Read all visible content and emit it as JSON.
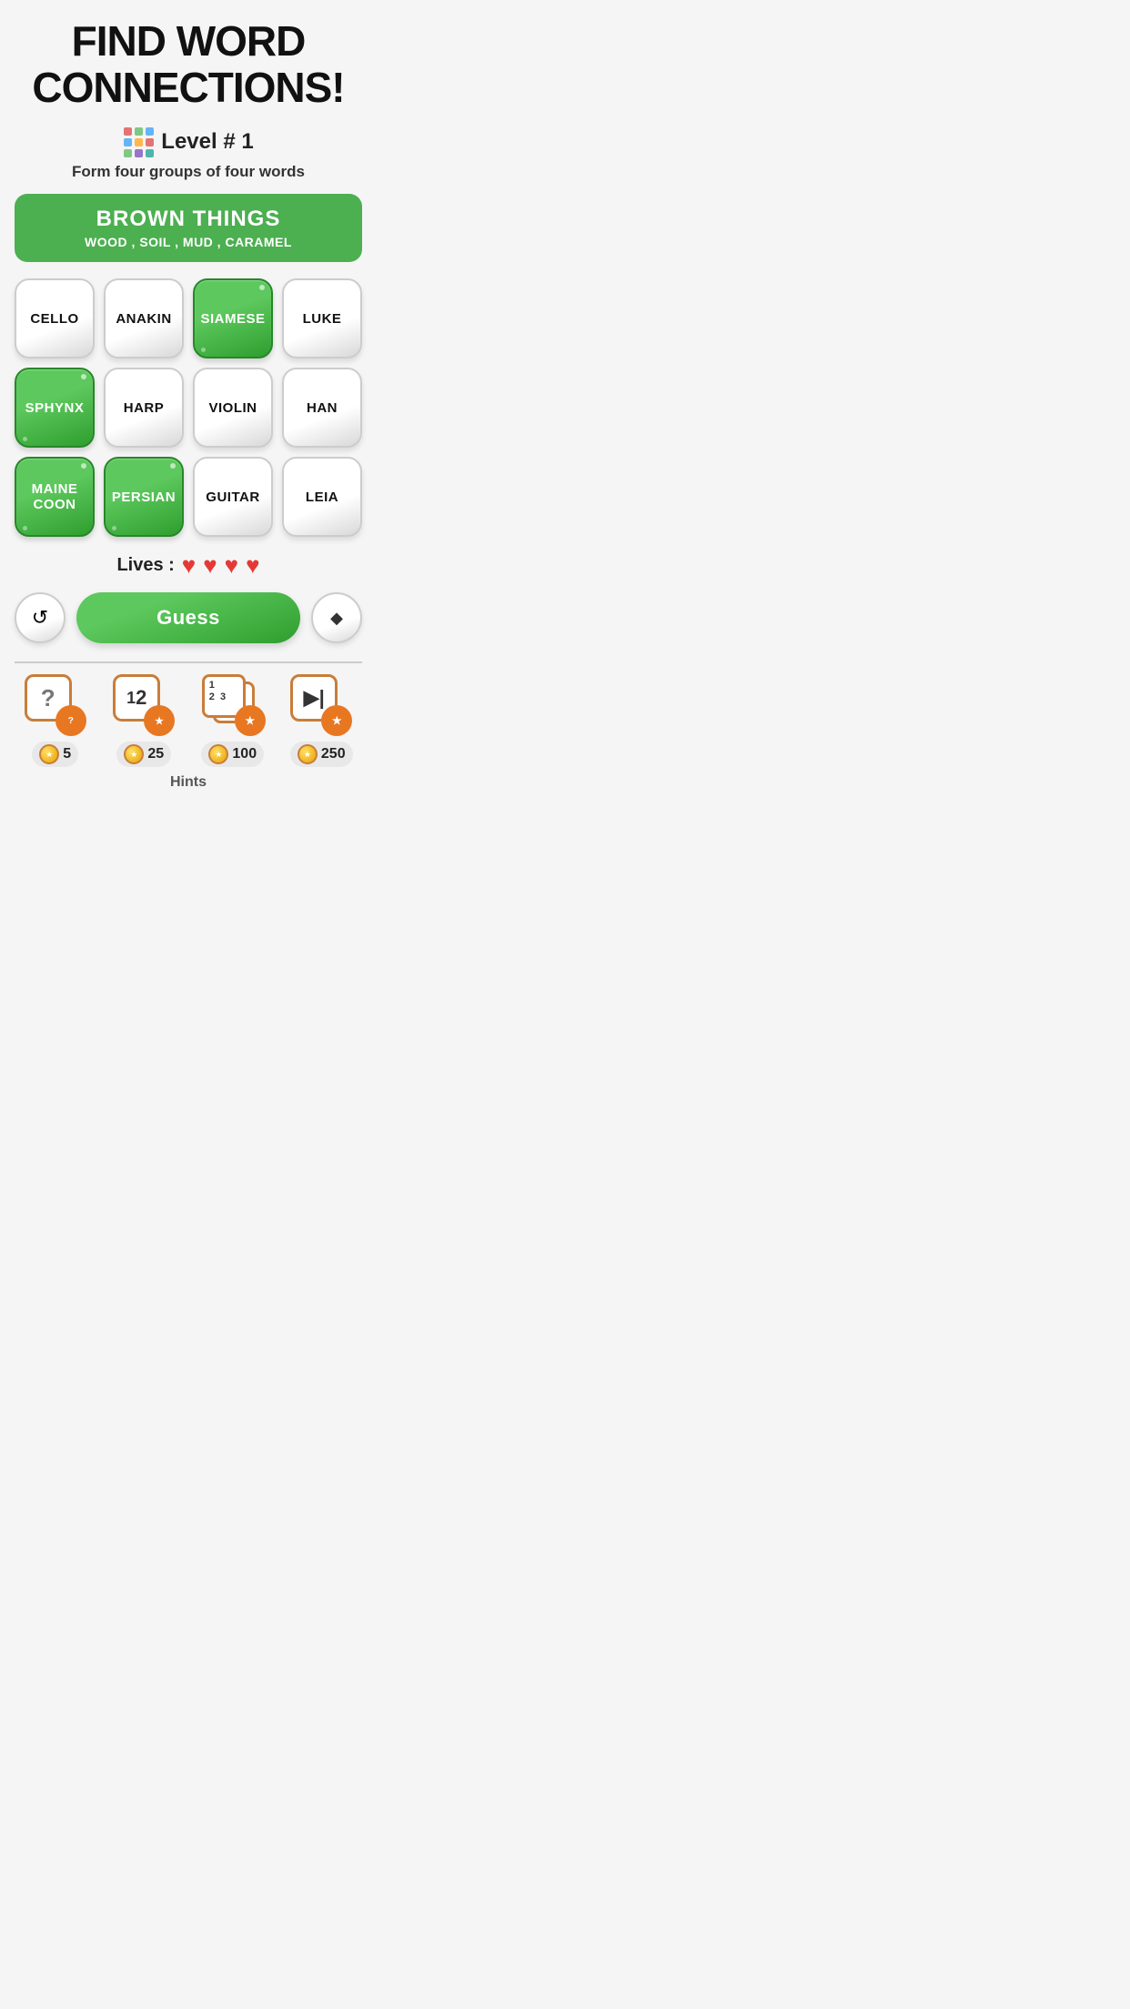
{
  "header": {
    "title": "FIND WORD\nCONNECTIONS!"
  },
  "level": {
    "number": "Level # 1",
    "subtitle": "Form four groups of four words"
  },
  "solved_group": {
    "title": "BROWN THINGS",
    "words": "WOOD , SOIL , MUD , CARAMEL"
  },
  "tiles": [
    {
      "id": 0,
      "label": "CELLO",
      "selected": false
    },
    {
      "id": 1,
      "label": "ANAKIN",
      "selected": false
    },
    {
      "id": 2,
      "label": "SIAMESE",
      "selected": true
    },
    {
      "id": 3,
      "label": "LUKE",
      "selected": false
    },
    {
      "id": 4,
      "label": "SPHYNX",
      "selected": true
    },
    {
      "id": 5,
      "label": "HARP",
      "selected": false
    },
    {
      "id": 6,
      "label": "VIOLIN",
      "selected": false
    },
    {
      "id": 7,
      "label": "HAN",
      "selected": false
    },
    {
      "id": 8,
      "label": "MAINE\nCOON",
      "selected": true
    },
    {
      "id": 9,
      "label": "PERSIAN",
      "selected": true
    },
    {
      "id": 10,
      "label": "GUITAR",
      "selected": false
    },
    {
      "id": 11,
      "label": "LEIA",
      "selected": false
    }
  ],
  "lives": {
    "label": "Lives :",
    "count": 4
  },
  "buttons": {
    "shuffle": "↺",
    "guess": "Guess",
    "eraser": "◆"
  },
  "hints": [
    {
      "id": "hint1",
      "type": "question",
      "cost": 5
    },
    {
      "id": "hint2",
      "type": "12",
      "cost": 25
    },
    {
      "id": "hint3",
      "type": "123",
      "cost": 100
    },
    {
      "id": "hint4",
      "type": "play",
      "cost": 250
    }
  ],
  "hints_label": "Hints",
  "colors": {
    "green": "#4caf50",
    "green_dark": "#2e7d32",
    "tile_bg": "#ffffff",
    "selected_green": "#43a047",
    "heart": "#e53935"
  }
}
